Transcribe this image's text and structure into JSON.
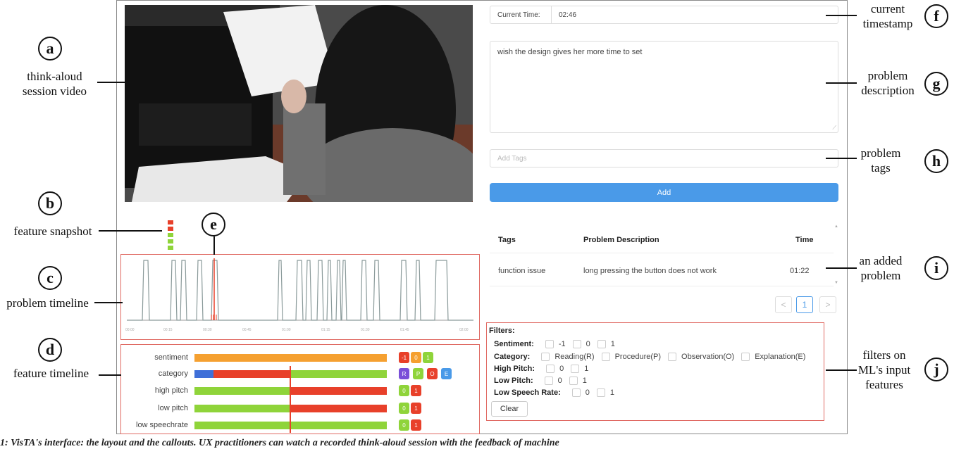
{
  "annotations": {
    "a": {
      "letter": "a",
      "lines": [
        "think-aloud",
        "session video"
      ]
    },
    "b": {
      "letter": "b",
      "lines": [
        "feature snapshot"
      ]
    },
    "c": {
      "letter": "c",
      "lines": [
        "problem timeline"
      ]
    },
    "d": {
      "letter": "d",
      "lines": [
        "feature timeline"
      ]
    },
    "e": {
      "letter": "e"
    },
    "f": {
      "letter": "f",
      "lines": [
        "current",
        "timestamp"
      ]
    },
    "g": {
      "letter": "g",
      "lines": [
        "problem",
        "description"
      ]
    },
    "h": {
      "letter": "h",
      "lines": [
        "problem",
        "tags"
      ]
    },
    "i": {
      "letter": "i",
      "lines": [
        "an added",
        "problem"
      ]
    },
    "j": {
      "letter": "j",
      "lines": [
        "filters on",
        "ML's input",
        "features"
      ]
    }
  },
  "panel": {
    "current_time_label": "Current Time:",
    "current_time_value": "02:46",
    "description_text": "wish the design gives her more time to set",
    "tags_placeholder": "Add Tags",
    "add_button": "Add"
  },
  "table": {
    "headers": [
      "Tags",
      "Problem Description",
      "Time"
    ],
    "rows": [
      {
        "tag": "function issue",
        "description": "long pressing the button does not work",
        "time": "01:22"
      }
    ]
  },
  "pagination": {
    "prev": "<",
    "current": "1",
    "next": ">"
  },
  "filters": {
    "title": "Filters:",
    "sentiment": {
      "label": "Sentiment:",
      "options": [
        "-1",
        "0",
        "1"
      ]
    },
    "category": {
      "label": "Category:",
      "options": [
        "Reading(R)",
        "Procedure(P)",
        "Observation(O)",
        "Explanation(E)"
      ]
    },
    "high_pitch": {
      "label": "High Pitch:",
      "options": [
        "0",
        "1"
      ]
    },
    "low_pitch": {
      "label": "Low Pitch:",
      "options": [
        "0",
        "1"
      ]
    },
    "low_speech_rate": {
      "label": "Low Speech Rate:",
      "options": [
        "0",
        "1"
      ]
    },
    "clear_button": "Clear"
  },
  "features": {
    "labels": [
      "sentiment",
      "category",
      "high pitch",
      "low pitch",
      "low speechrate"
    ],
    "sentiment_chips": [
      "-1",
      "0",
      "1"
    ],
    "category_chips": [
      "R",
      "P",
      "O",
      "E"
    ],
    "binary_chips": [
      "0",
      "1"
    ]
  },
  "colors": {
    "orange": "#f5a030",
    "green": "#8fd43a",
    "red": "#e8402a",
    "blue": "#3f6fd8",
    "accent": "#4a9ae8",
    "annotation_red": "#e06a63"
  },
  "caption": "1: VisTA's interface: the layout and the callouts. UX practitioners can watch a recorded think-aloud session with the feedback of machine"
}
